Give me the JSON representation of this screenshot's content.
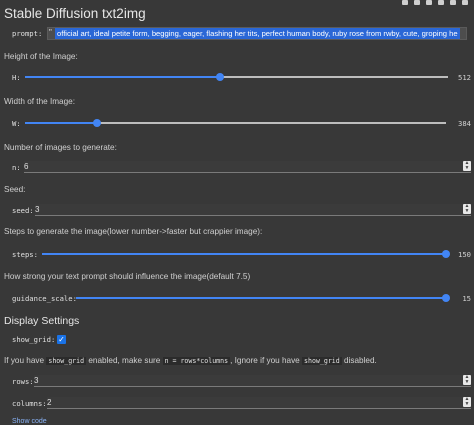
{
  "title": "Stable Diffusion txt2img",
  "prompt": {
    "key": "prompt:",
    "quote": "\"",
    "value": "official art, ideal petite form, begging, eager, flashing her tits, perfect human body, ruby rose from rwby, cute, groping he"
  },
  "height": {
    "label": "Height of the Image:",
    "key": "H:",
    "value": "512",
    "level": 0.46
  },
  "width": {
    "label": "Width of the Image:",
    "key": "W:",
    "value": "384",
    "level": 0.17
  },
  "num_images": {
    "label": "Number of images to generate:",
    "key": "n:",
    "value": "6"
  },
  "seed": {
    "label": "Seed:",
    "key": "seed:",
    "value": "3"
  },
  "steps": {
    "label": "Steps to generate the image(lower number->faster but crappier image):",
    "key": "steps:",
    "value": "150",
    "level": 1.0
  },
  "guidance": {
    "label": "How strong your text prompt should influence the image(default 7.5)",
    "key": "guidance_scale:",
    "value": "15",
    "level": 1.0
  },
  "display": {
    "heading": "Display Settings",
    "show_grid_key": "show_grid:",
    "show_grid_checked": true,
    "note_prefix": "If you have",
    "note_code1": "show_grid",
    "note_mid": "enabled, make sure",
    "note_code2": "n = rows*columns",
    "note_mid2": ", Ignore if you have",
    "note_code3": "show_grid",
    "note_suffix": "disabled.",
    "rows_key": "rows:",
    "rows_value": "3",
    "columns_key": "columns:",
    "columns_value": "2"
  },
  "show_code_label": "Show code",
  "colors": {
    "accent": "#4285f4",
    "background": "#383838",
    "selection": "#2a67d6"
  }
}
